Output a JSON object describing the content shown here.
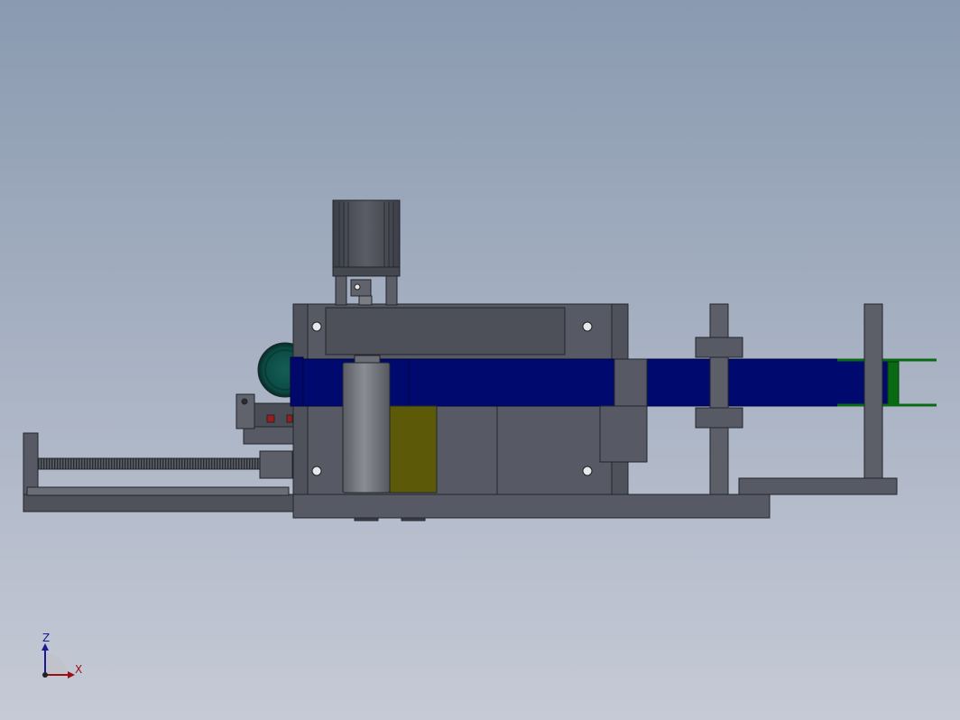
{
  "viewport": {
    "background_top": "#8a9ab0",
    "background_bottom": "#c6cad6"
  },
  "colors": {
    "frame_gray": "#575a64",
    "frame_dark": "#454852",
    "edge": "#22252c",
    "belt_blue": "#000a6e",
    "belt_blue_edge": "#000340",
    "roller_gray": "#70737a",
    "roller_yellow": "#5c5a08",
    "belt_end_green": "#0a6a14",
    "motor_body": "#4d5058",
    "round_part": "#0d4a44",
    "sensor_red": "#9a1c1c",
    "triad_z": "#1a1a90",
    "triad_x": "#9a1010"
  },
  "triad": {
    "z_label": "Z",
    "x_label": "X"
  }
}
